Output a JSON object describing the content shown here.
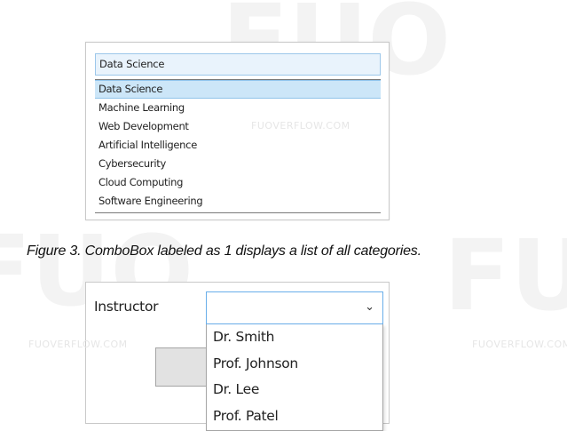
{
  "figure3": {
    "combobox": {
      "selected_value": "Data Science",
      "options": [
        "Data Science",
        "Machine Learning",
        "Web Development",
        "Artificial Intelligence",
        "Cybersecurity",
        "Cloud Computing",
        "Software Engineering"
      ]
    },
    "caption": "Figure 3. ComboBox labeled as 1 displays a list of all categories."
  },
  "instructor_panel": {
    "label": "Instructor",
    "combobox": {
      "selected_value": "",
      "options": [
        "Dr. Smith",
        "Prof. Johnson",
        "Dr. Lee",
        "Prof. Patel"
      ]
    }
  },
  "watermark": "FUOVERFLOW.COM",
  "watermark_logo": "FUO",
  "colors": {
    "selection_fill": "#cce6f8",
    "selection_border": "#8fc3ea",
    "focus_border": "#69aeea"
  },
  "icons": {
    "dropdown": "chevron-down-icon"
  }
}
